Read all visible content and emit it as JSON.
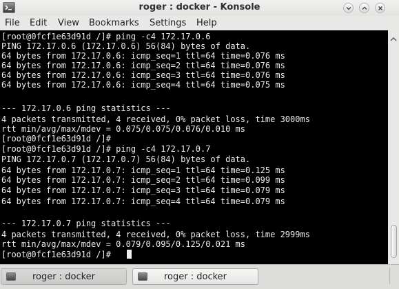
{
  "window": {
    "title": "roger : docker - Konsole"
  },
  "menu": [
    "File",
    "Edit",
    "View",
    "Bookmarks",
    "Settings",
    "Help"
  ],
  "terminal": {
    "lines": [
      "[root@0fcf1e63d91d /]# ping -c4 172.17.0.6",
      "PING 172.17.0.6 (172.17.0.6) 56(84) bytes of data.",
      "64 bytes from 172.17.0.6: icmp_seq=1 ttl=64 time=0.076 ms",
      "64 bytes from 172.17.0.6: icmp_seq=2 ttl=64 time=0.076 ms",
      "64 bytes from 172.17.0.6: icmp_seq=3 ttl=64 time=0.076 ms",
      "64 bytes from 172.17.0.6: icmp_seq=4 ttl=64 time=0.075 ms",
      "",
      "--- 172.17.0.6 ping statistics ---",
      "4 packets transmitted, 4 received, 0% packet loss, time 3000ms",
      "rtt min/avg/max/mdev = 0.075/0.075/0.076/0.010 ms",
      "[root@0fcf1e63d91d /]#",
      "[root@0fcf1e63d91d /]# ping -c4 172.17.0.7",
      "PING 172.17.0.7 (172.17.0.7) 56(84) bytes of data.",
      "64 bytes from 172.17.0.7: icmp_seq=1 ttl=64 time=0.125 ms",
      "64 bytes from 172.17.0.7: icmp_seq=2 ttl=64 time=0.099 ms",
      "64 bytes from 172.17.0.7: icmp_seq=3 ttl=64 time=0.079 ms",
      "64 bytes from 172.17.0.7: icmp_seq=4 ttl=64 time=0.079 ms",
      "",
      "--- 172.17.0.7 ping statistics ---",
      "4 packets transmitted, 4 received, 0% packet loss, time 2999ms",
      "rtt min/avg/max/mdev = 0.079/0.095/0.125/0.021 ms",
      "[root@0fcf1e63d91d /]#"
    ],
    "foreground": "#ededed",
    "background": "#000000"
  },
  "tabs": [
    {
      "label": "roger : docker"
    },
    {
      "label": "roger : docker"
    }
  ]
}
